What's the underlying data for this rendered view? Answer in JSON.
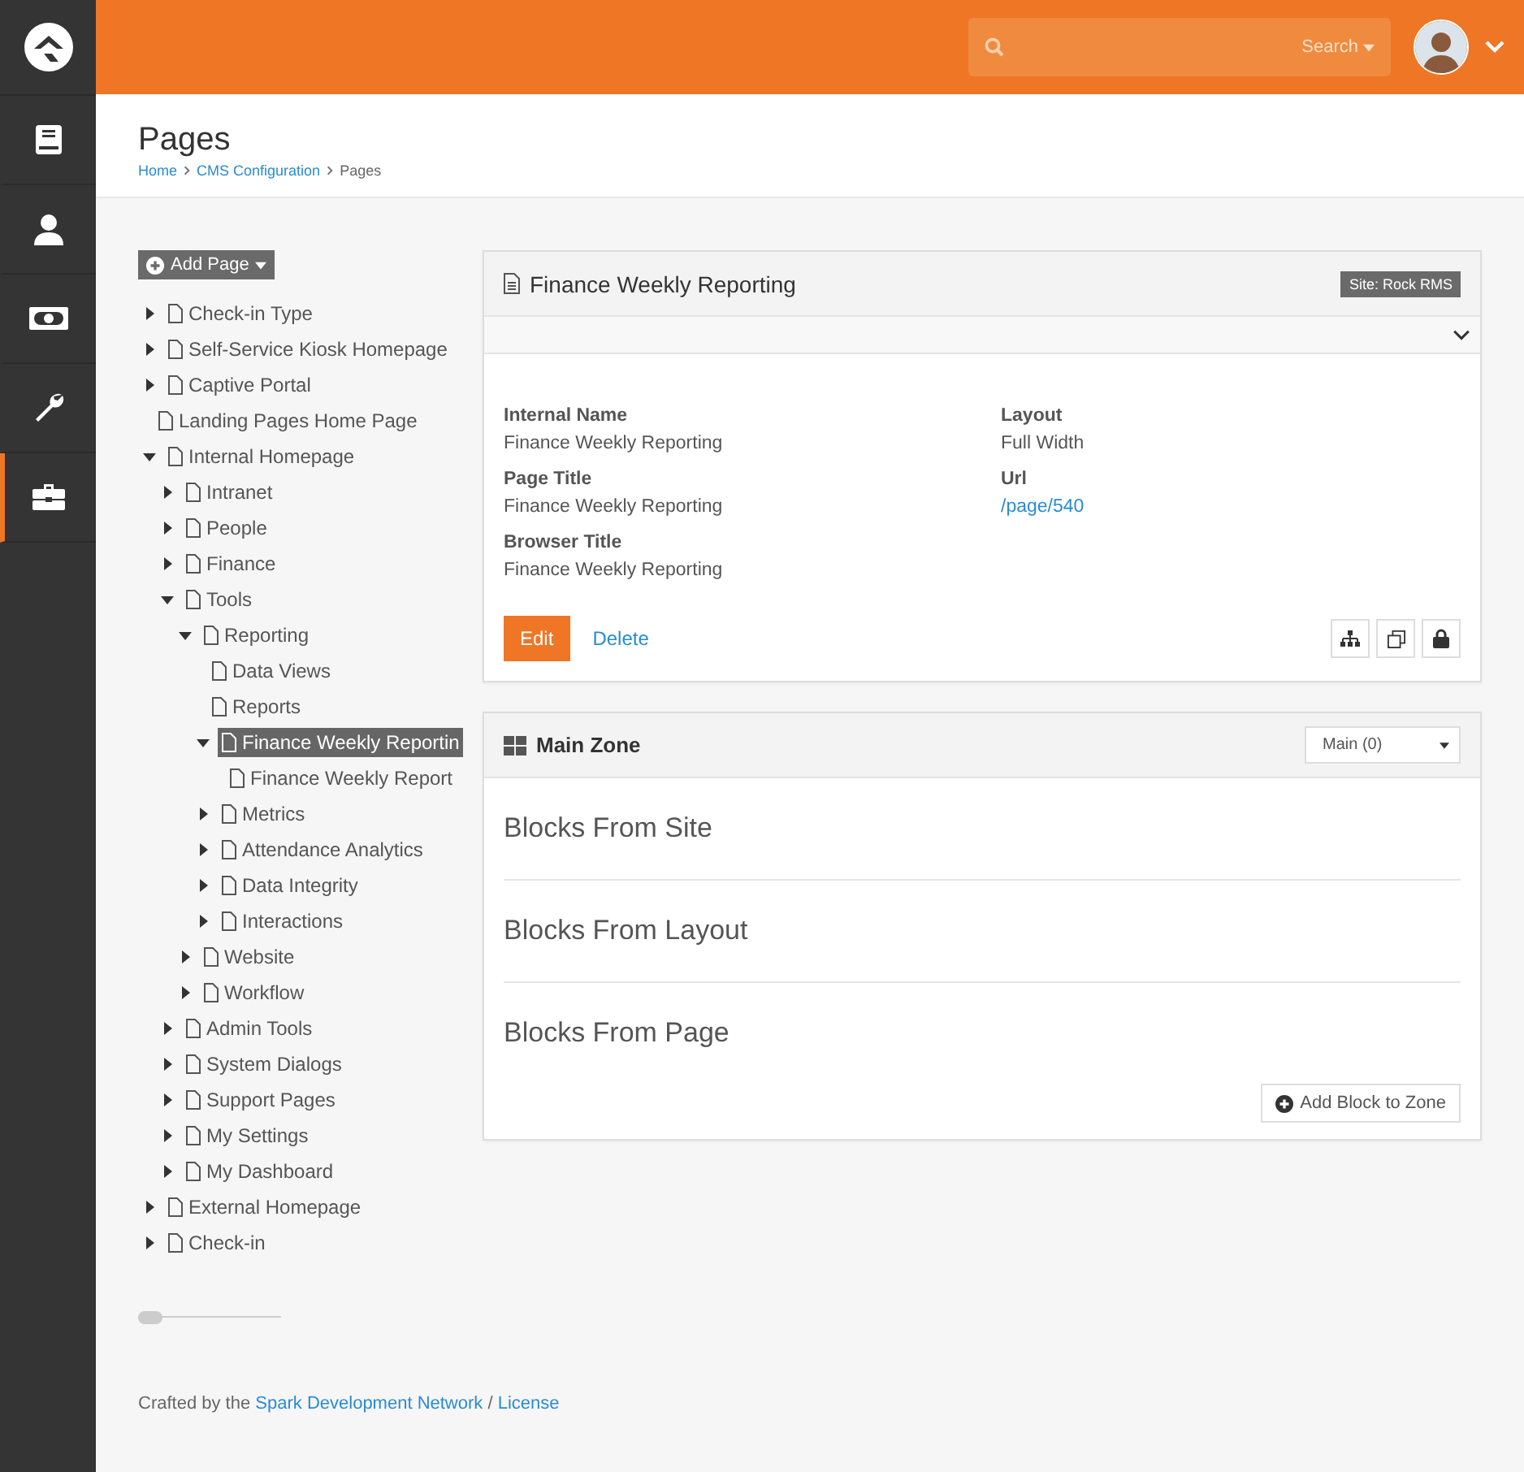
{
  "nav": [
    {
      "kind": "logo"
    },
    {
      "kind": "book",
      "selected": false
    },
    {
      "kind": "person",
      "selected": false
    },
    {
      "kind": "money",
      "selected": false
    },
    {
      "kind": "wrench",
      "selected": false
    },
    {
      "kind": "briefcase",
      "selected": true
    }
  ],
  "topbar": {
    "search_button": "Search"
  },
  "header": {
    "title": "Pages",
    "breadcrumbs": [
      "Home",
      "CMS Configuration",
      "Pages"
    ]
  },
  "add_page_button": "Add Page",
  "tree": [
    {
      "label": "Check-in Type",
      "expanded": false,
      "selected": false
    },
    {
      "label": "Self-Service Kiosk Homepage",
      "expanded": false,
      "selected": false
    },
    {
      "label": "Captive Portal",
      "expanded": false,
      "selected": false
    },
    {
      "label": "Landing Pages Home Page",
      "selected": false
    },
    {
      "label": "Internal Homepage",
      "expanded": true,
      "selected": false,
      "children": [
        {
          "label": "Intranet",
          "expanded": false,
          "selected": false
        },
        {
          "label": "People",
          "expanded": false,
          "selected": false
        },
        {
          "label": "Finance",
          "expanded": false,
          "selected": false
        },
        {
          "label": "Tools",
          "expanded": true,
          "selected": false,
          "children": [
            {
              "label": "Reporting",
              "expanded": true,
              "selected": false,
              "children": [
                {
                  "label": "Data Views",
                  "selected": false
                },
                {
                  "label": "Reports",
                  "selected": false
                },
                {
                  "label": "Finance Weekly Reportin",
                  "expanded": true,
                  "selected": true,
                  "children": [
                    {
                      "label": "Finance Weekly Report",
                      "selected": false
                    }
                  ]
                },
                {
                  "label": "Metrics",
                  "expanded": false,
                  "selected": false
                },
                {
                  "label": "Attendance Analytics",
                  "expanded": false,
                  "selected": false
                },
                {
                  "label": "Data Integrity",
                  "expanded": false,
                  "selected": false
                },
                {
                  "label": "Interactions",
                  "expanded": false,
                  "selected": false
                }
              ]
            },
            {
              "label": "Website",
              "expanded": false,
              "selected": false
            },
            {
              "label": "Workflow",
              "expanded": false,
              "selected": false
            }
          ]
        },
        {
          "label": "Admin Tools",
          "expanded": false,
          "selected": false
        },
        {
          "label": "System Dialogs",
          "expanded": false,
          "selected": false
        },
        {
          "label": "Support Pages",
          "expanded": false,
          "selected": false
        },
        {
          "label": "My Settings",
          "expanded": false,
          "selected": false
        },
        {
          "label": "My Dashboard",
          "expanded": false,
          "selected": false
        }
      ]
    },
    {
      "label": "External Homepage",
      "expanded": false,
      "selected": false
    },
    {
      "label": "Check-in",
      "expanded": false,
      "selected": false
    }
  ],
  "page_panel": {
    "title": "Finance Weekly Reporting",
    "site_badge": "Site: Rock RMS",
    "fields": [
      {
        "label": "Internal Name",
        "value": "Finance Weekly Reporting",
        "kind": "text"
      },
      {
        "label": "Layout",
        "value": "Full Width",
        "kind": "text"
      },
      {
        "label": "Page Title",
        "value": "Finance Weekly Reporting",
        "kind": "text"
      },
      {
        "label": "Url",
        "value": "/page/540",
        "kind": "link"
      },
      {
        "label": "Browser Title",
        "value": "Finance Weekly Reporting",
        "kind": "text"
      }
    ],
    "edit_button": "Edit",
    "delete_link": "Delete"
  },
  "zone_panel": {
    "title": "Main Zone",
    "zone_select": "Main (0)",
    "sections": [
      "Blocks From Site",
      "Blocks From Layout",
      "Blocks From Page"
    ],
    "add_block_button": "Add Block to Zone"
  },
  "footer": {
    "prefix": "Crafted by the ",
    "link": "Spark Development Network",
    "separator": " / ",
    "license": "License"
  }
}
